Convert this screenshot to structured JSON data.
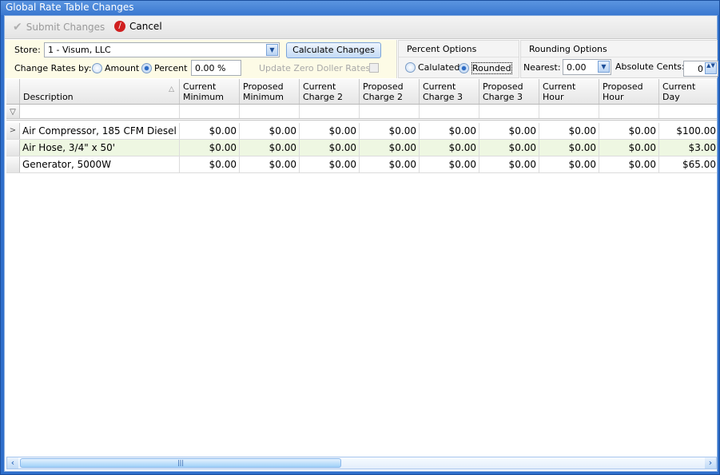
{
  "window": {
    "title": "Global Rate Table Changes"
  },
  "toolbar": {
    "submit_label": "Submit Changes",
    "cancel_label": "Cancel"
  },
  "options": {
    "store_label": "Store:",
    "store_value": "1 - Visum, LLC",
    "calculate_label": "Calculate Changes",
    "change_rates_label": "Change Rates by:",
    "amount_label": "Amount",
    "percent_label": "Percent",
    "percent_selected": true,
    "percent_value": "0.00 %",
    "update_zero_label": "Update Zero Doller Rates?:",
    "update_zero_checked": false
  },
  "percent_options": {
    "title": "Percent Options",
    "calculated_label": "Calulated",
    "rounded_label": "Rounded",
    "selected": "Rounded"
  },
  "rounding_options": {
    "title": "Rounding Options",
    "nearest_label": "Nearest:",
    "nearest_value": "0.00",
    "absolute_cents_label": "Absolute Cents:",
    "absolute_cents_value": "0"
  },
  "grid": {
    "columns": [
      "Description",
      "Current Minimum",
      "Proposed Minimum",
      "Current Charge 2",
      "Proposed Charge 2",
      "Current Charge 3",
      "Proposed Charge 3",
      "Current Hour",
      "Proposed Hour",
      "Current Day"
    ],
    "sort_column": "Description",
    "sort_direction": "ascending",
    "rows": [
      [
        "Air Compressor, 185 CFM  Diesel",
        "$0.00",
        "$0.00",
        "$0.00",
        "$0.00",
        "$0.00",
        "$0.00",
        "$0.00",
        "$0.00",
        "$100.00"
      ],
      [
        "Air Hose, 3/4\" x 50'",
        "$0.00",
        "$0.00",
        "$0.00",
        "$0.00",
        "$0.00",
        "$0.00",
        "$0.00",
        "$0.00",
        "$3.00"
      ],
      [
        "Generator, 5000W",
        "$0.00",
        "$0.00",
        "$0.00",
        "$0.00",
        "$0.00",
        "$0.00",
        "$0.00",
        "$0.00",
        "$65.00"
      ]
    ],
    "current_row": 0
  },
  "scrollbar": {
    "horizontal_position": 0
  }
}
